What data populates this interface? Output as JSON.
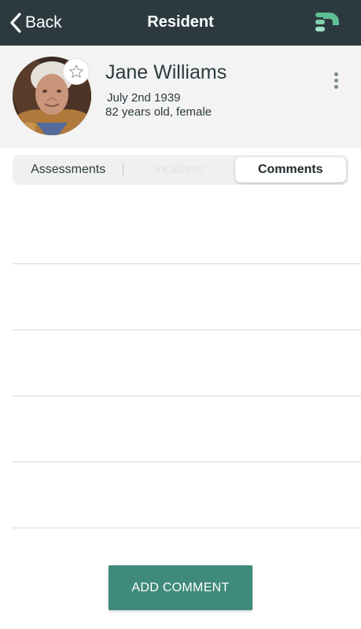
{
  "navbar": {
    "back_label": "Back",
    "title": "Resident",
    "brand_icon": "brand-logo-icon",
    "background": "#2c3a3f"
  },
  "resident": {
    "name": "Jane Williams",
    "birth_date": "July 2nd 1939",
    "age_gender": "82 years old, female",
    "favorite": false
  },
  "tabs": [
    {
      "label": "Assessments",
      "active": false
    },
    {
      "label": "Incidents",
      "active": false
    },
    {
      "label": "Comments",
      "active": true
    }
  ],
  "comments": [
    {
      "text": ""
    },
    {
      "text": ""
    },
    {
      "text": ""
    },
    {
      "text": ""
    },
    {
      "text": ""
    }
  ],
  "actions": {
    "add_comment_label": "ADD COMMENT"
  },
  "colors": {
    "accent": "#3f8a7a",
    "brand_green": "#5dbf93",
    "text": "#2c3a3f"
  }
}
